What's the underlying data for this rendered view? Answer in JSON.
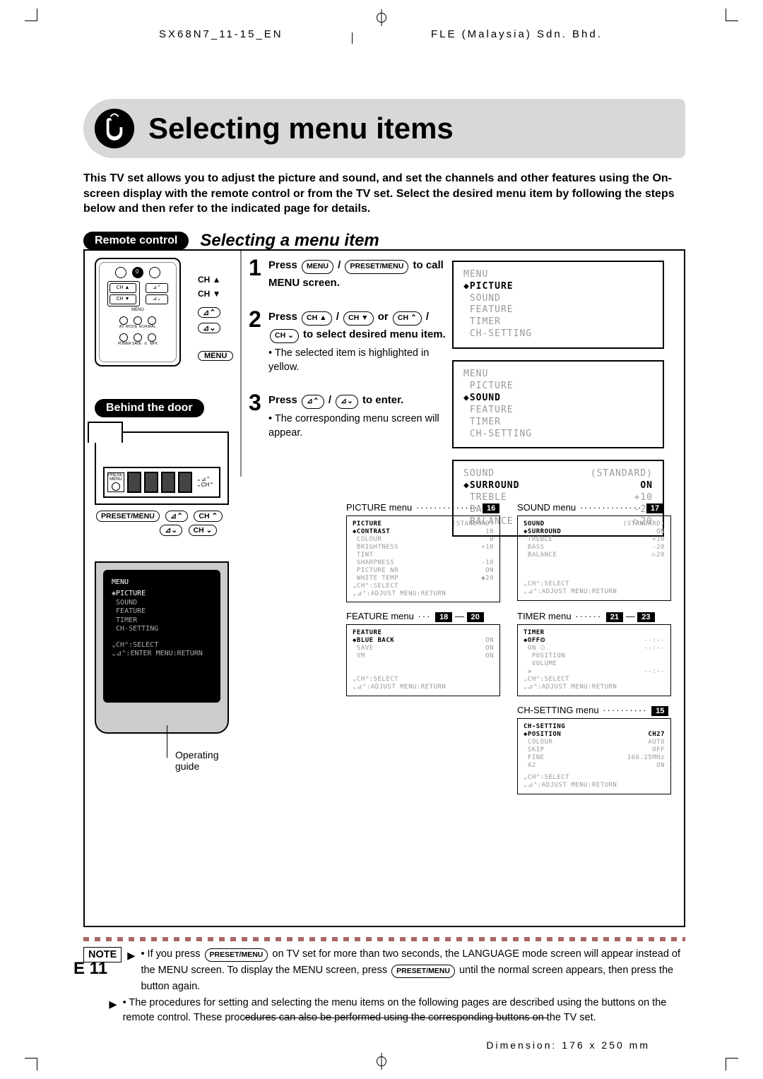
{
  "doc_header": {
    "left": "SX68N7_11-15_EN",
    "right": "FLE (Malaysia) Sdn. Bhd."
  },
  "title": "Selecting menu items",
  "intro": "This TV set allows you to adjust the picture and sound, and set the channels and other features using the On-screen display with the remote control or from the TV set. Select the desired menu item by following the steps below and then refer to the indicated page for details.",
  "pill_remote": "Remote control",
  "section_title": "Selecting a menu item",
  "pill_behind": "Behind the door",
  "remote_labels": {
    "ch_up": "CH ▲",
    "ch_down": "CH ▼",
    "menu": "MENU",
    "preset_menu": "PRESET/MENU",
    "ch_u2": "CH ⌃",
    "ch_d2": "CH ⌄",
    "adj_up": "⊿⌃",
    "adj_down": "⊿⌄"
  },
  "steps": {
    "s1_a": "Press ",
    "s1_b": " / ",
    "s1_c": " to call MENU screen.",
    "s2_a": "Press ",
    "s2_b": " / ",
    "s2_c": " or ",
    "s2_d": " / ",
    "s2_e": " to select desired menu item.",
    "s2_sub": "• The selected item is highlighted in yellow.",
    "s3_a": "Press ",
    "s3_b": " / ",
    "s3_c": " to enter.",
    "s3_sub": "• The corresponding menu screen will appear."
  },
  "osd_menu": {
    "header": "MENU",
    "items": [
      "PICTURE",
      "SOUND",
      "FEATURE",
      "TIMER",
      "CH-SETTING"
    ],
    "sel1": 0,
    "sel2": 1
  },
  "osd_sound": {
    "header": "SOUND",
    "preset": "(STANDARD)",
    "rows": [
      [
        "SURROUND",
        "ON"
      ],
      [
        "TREBLE",
        "+10"
      ],
      [
        "BASS",
        "-20"
      ],
      [
        "BALANCE",
        "▷20"
      ]
    ]
  },
  "tv_menu": {
    "header": "MENU",
    "items": [
      "PICTURE",
      "SOUND",
      "FEATURE",
      "TIMER",
      "CH-SETTING"
    ],
    "guide1": "⌄CH⌃:SELECT",
    "guide2": "⌄⊿⌃:ENTER   MENU:RETURN"
  },
  "og": "Operating guide",
  "menus_labels": {
    "picture": "PICTURE menu",
    "sound": "SOUND menu",
    "feature": "FEATURE menu",
    "timer": "TIMER menu",
    "ch": "CH-SETTING menu",
    "p_pic": "16",
    "p_snd": "17",
    "p_feat_a": "18",
    "p_feat_b": "20",
    "p_tim_a": "21",
    "p_tim_b": "23",
    "p_ch": "15"
  },
  "mini": {
    "picture": {
      "header": "PICTURE",
      "preset": "(STANDARD)",
      "rows": [
        [
          "CONTRAST",
          "10"
        ],
        [
          "COLOUR",
          "0"
        ],
        [
          "BRIGHTNESS",
          "+10"
        ],
        [
          "TINT",
          ""
        ],
        [
          "SHARPNESS",
          "-10"
        ],
        [
          "PICTURE NR",
          "ON"
        ],
        [
          "WHITE TEMP",
          "◆20"
        ]
      ],
      "g1": "⌄CH⌃:SELECT",
      "g2": "⌄⊿⌃:ADJUST   MENU:RETURN"
    },
    "sound": {
      "header": "SOUND",
      "preset": "(STANDARD)",
      "rows": [
        [
          "SURROUND",
          "ON"
        ],
        [
          "TREBLE",
          "+10"
        ],
        [
          "BASS",
          "-20"
        ],
        [
          "BALANCE",
          "▷20"
        ]
      ],
      "g1": "⌄CH⌃:SELECT",
      "g2": "⌄⊿⌃:ADJUST   MENU:RETURN"
    },
    "feature": {
      "header": "FEATURE",
      "rows": [
        [
          "BLUE BACK",
          "ON"
        ],
        [
          "SAVE",
          "ON"
        ],
        [
          "VM",
          "ON"
        ]
      ],
      "g1": "⌄CH⌃:SELECT",
      "g2": "⌄⊿⌃:ADJUST   MENU:RETURN"
    },
    "timer": {
      "header": "TIMER",
      "rows": [
        [
          "OFF⏲",
          "--:--"
        ],
        [
          "ON ⏲",
          "--:--"
        ],
        [
          "  POSITION",
          ""
        ],
        [
          "  VOLUME",
          ""
        ],
        [
          "✉",
          "--:--"
        ]
      ],
      "g1": "⌄CH⌃:SELECT",
      "g2": "⌄⊿⌃:ADJUST   MENU:RETURN"
    },
    "ch": {
      "header": "CH-SETTING",
      "rows": [
        [
          "POSITION",
          "CH27"
        ],
        [
          "COLOUR",
          "AUTO"
        ],
        [
          "SKIP",
          "OFF"
        ],
        [
          "FINE",
          "168.25MHz"
        ],
        [
          "A2",
          "ON"
        ]
      ],
      "g1": "⌄CH⌃:SELECT",
      "g2": "⌄⊿⌃:ADJUST   MENU:RETURN"
    }
  },
  "note_label": "NOTE",
  "note1_a": "If you press ",
  "note1_b": " on TV set for more than two seconds, the LANGUAGE mode screen will appear instead of the MENU screen. To display the MENU screen, press ",
  "note1_c": " until the normal screen appears, then press the button again.",
  "note2": "The procedures for setting and selecting the menu items on the following pages are described using the buttons on the remote control. These procedures can also be performed using the corresponding buttons on the TV set.",
  "page_num": "E 11",
  "dimension": "Dimension: 176 x 250 mm"
}
